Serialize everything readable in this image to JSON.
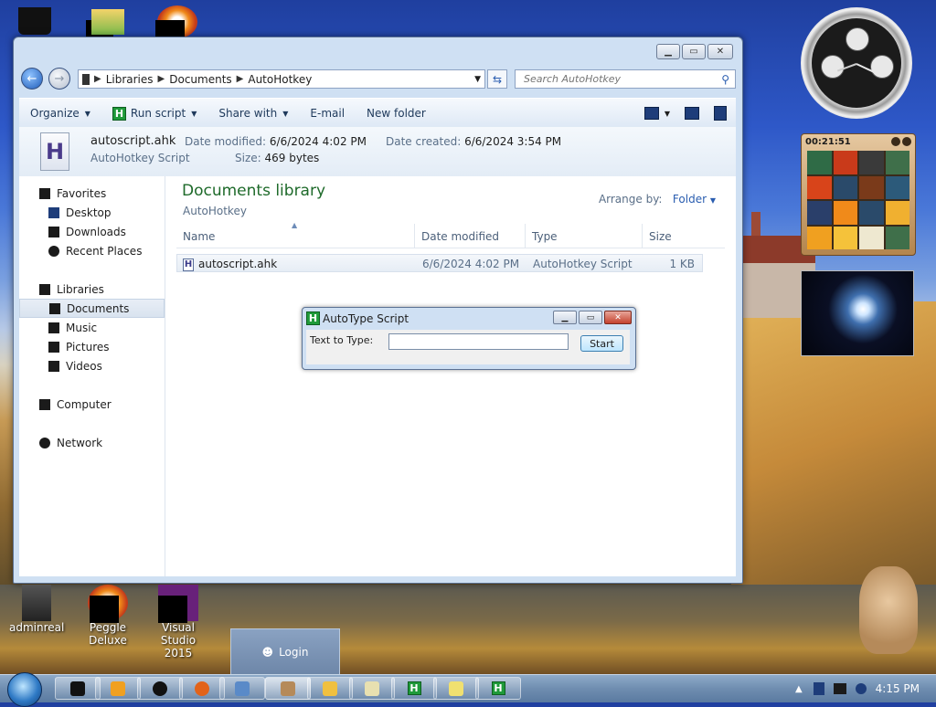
{
  "explorer": {
    "breadcrumb": [
      "Libraries",
      "Documents",
      "AutoHotkey"
    ],
    "search_placeholder": "Search AutoHotkey",
    "toolbar": {
      "organize": "Organize",
      "run_script": "Run script",
      "share_with": "Share with",
      "email": "E-mail",
      "new_folder": "New folder"
    },
    "details": {
      "file_name": "autoscript.ahk",
      "file_type": "AutoHotkey Script",
      "date_modified_label": "Date modified:",
      "date_modified": "6/6/2024 4:02 PM",
      "date_created_label": "Date created:",
      "date_created": "6/6/2024 3:54 PM",
      "size_label": "Size:",
      "size": "469 bytes"
    },
    "sidebar": {
      "favorites": "Favorites",
      "desktop": "Desktop",
      "downloads": "Downloads",
      "recent_places": "Recent Places",
      "libraries": "Libraries",
      "documents": "Documents",
      "music": "Music",
      "pictures": "Pictures",
      "videos": "Videos",
      "computer": "Computer",
      "network": "Network"
    },
    "content": {
      "title": "Documents library",
      "subtitle": "AutoHotkey",
      "arrange_label": "Arrange by:",
      "arrange_value": "Folder",
      "columns": {
        "name": "Name",
        "date_modified": "Date modified",
        "type": "Type",
        "size": "Size"
      },
      "rows": [
        {
          "name": "autoscript.ahk",
          "date": "6/6/2024 4:02 PM",
          "type": "AutoHotkey Script",
          "size": "1 KB"
        }
      ]
    }
  },
  "dialog": {
    "title": "AutoType Script",
    "label": "Text to Type:",
    "input_value": "",
    "start": "Start"
  },
  "gadgets": {
    "timer": "00:21:51"
  },
  "desktop_icons": {
    "adminreal": "adminreal",
    "peggle": "Peggle Deluxe",
    "vs_line1": "Visual Studio",
    "vs_line2": "2015",
    "login": "Login"
  },
  "taskbar": {
    "time": "4:15 PM"
  },
  "colors": {
    "library_title": "#1e6a2a",
    "link_blue": "#2a5db0",
    "ahk_green": "#1f9a3a"
  }
}
